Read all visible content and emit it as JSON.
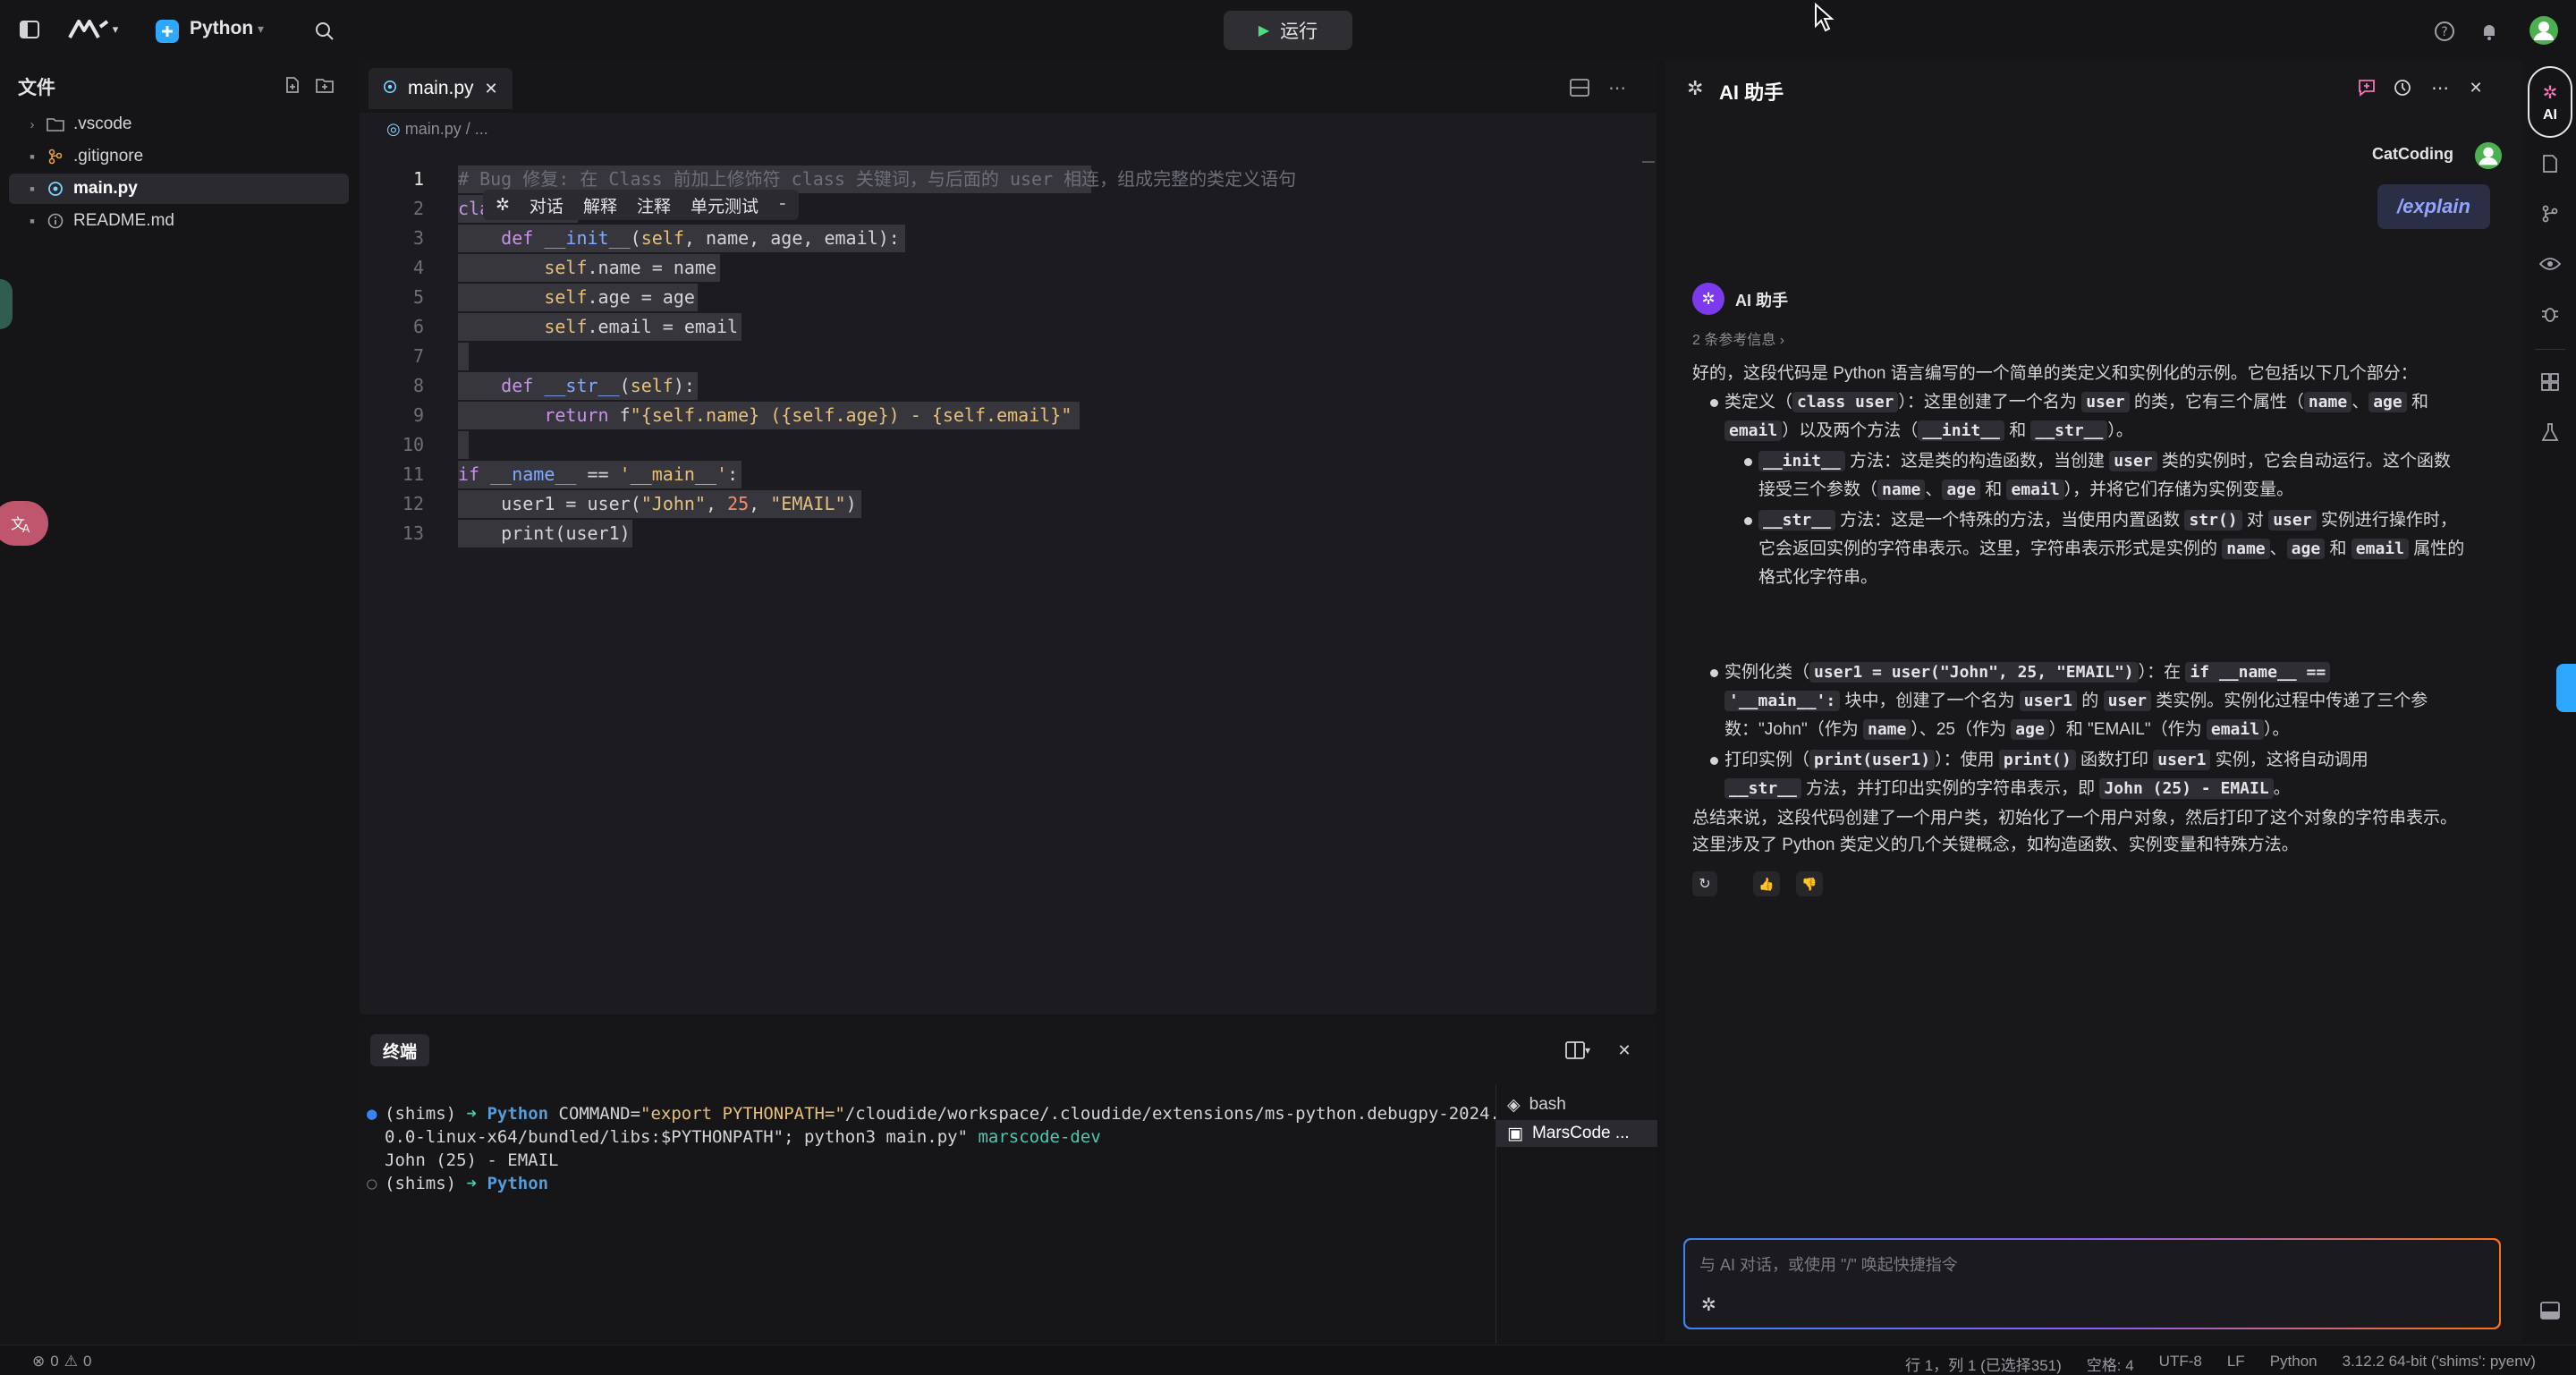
{
  "topbar": {
    "project_name": "Python",
    "run_label": "运行"
  },
  "sidebar": {
    "title": "文件",
    "items": [
      {
        "label": ".vscode",
        "type": "folder"
      },
      {
        "label": ".gitignore",
        "type": "git"
      },
      {
        "label": "main.py",
        "type": "python",
        "selected": true
      },
      {
        "label": "README.md",
        "type": "info"
      }
    ]
  },
  "editor": {
    "tab_label": "main.py",
    "breadcrumb": "main.py / ...",
    "inline_menu": [
      "对话",
      "解释",
      "注释",
      "单元测试"
    ],
    "lines": [
      "# Bug 修复: 在 Class 前加上修饰符 class 关键词，与后面的 user 相连，组成完整的类定义语句",
      "class user:",
      "    def __init__(self, name, age, email):",
      "        self.name = name",
      "        self.age = age",
      "        self.email = email",
      "",
      "    def __str__(self):",
      "        return f\"{self.name} ({self.age}) - {self.email}\"",
      "",
      "if __name__ == '__main__':",
      "    user1 = user(\"John\", 25, \"EMAIL\")",
      "    print(user1)"
    ]
  },
  "terminal": {
    "tab_label": "终端",
    "line1_prefix": "(shims)",
    "line1_cwd": "Python",
    "line1_cmd_a": "COMMAND=",
    "line1_cmd_b": "\"export PYTHONPATH=\"",
    "line1_cmd_c": "/cloudide/workspace/.cloudide/extensions/ms-python.debugpy-2024.",
    "line2": "0.0-linux-x64/bundled/libs:$PYTHONPATH\"; python3 main.py\"",
    "line2_tail": "marscode-dev",
    "line3": "John (25) - EMAIL",
    "line4_prefix": "(shims)",
    "line4_cwd": "Python",
    "sessions": [
      {
        "label": "bash",
        "selected": false
      },
      {
        "label": "MarsCode ...",
        "selected": true
      }
    ]
  },
  "ai": {
    "title": "AI 助手",
    "user_name": "CatCoding",
    "user_command": "/explain",
    "assistant_name": "AI 助手",
    "refs": "2 条参考信息",
    "intro": "好的，这段代码是 Python 语言编写的一个简单的类定义和实例化的示例。它包括以下几个部分：",
    "b1_a": "类定义（",
    "b1_chip1": "class user",
    "b1_b": "）：这里创建了一个名为",
    "b1_chip2": "user",
    "b1_c": "的类，它有三个属性（",
    "b1_chip3": "name",
    "b1_d": "、",
    "b1_chip4": "age",
    "b1_e": "和",
    "b1_chip5": "email",
    "b1_f": "）以及两个方法（",
    "b1_chip6": "__init__",
    "b1_g": "和",
    "b1_chip7": "__str__",
    "b1_h": "）。",
    "s1_chip": "__init__",
    "s1_a": "方法：这是类的构造函数，当创建",
    "s1_chip2": "user",
    "s1_b": "类的实例时，它会自动运行。这个函数",
    "s1_c": "接受三个参数（",
    "s1_chip3": "name",
    "s1_d": "、",
    "s1_chip4": "age",
    "s1_e": "和",
    "s1_chip5": "email",
    "s1_f": "），并将它们存储为实例变量。",
    "s2_chip": "__str__",
    "s2_a": "方法：这是一个特殊的方法，当使用内置函数",
    "s2_chip2": "str()",
    "s2_b": "对",
    "s2_chip3": "user",
    "s2_c": "实例进行操作时，",
    "s2_d": "它会返回实例的字符串表示。这里，字符串表示形式是实例的",
    "s2_chip4": "name",
    "s2_e": "、",
    "s2_chip5": "age",
    "s2_f": "和",
    "s2_chip6": "email",
    "s2_g": "属性的",
    "s2_h": "格式化字符串。",
    "b2_a": "实例化类（",
    "b2_chip1": "user1 = user(\"John\", 25, \"EMAIL\")",
    "b2_b": "）：在",
    "b2_chip2": "if __name__ ==",
    "b2_chip3": "'__main__':",
    "b2_c": "块中，创建了一个名为",
    "b2_chip4": "user1",
    "b2_d": "的",
    "b2_chip5": "user",
    "b2_e": "类实例。实例化过程中传递了三个参",
    "b2_f": "数：\"John\"（作为",
    "b2_chip6": "name",
    "b2_g": "）、25（作为",
    "b2_chip7": "age",
    "b2_h": "）和 \"EMAIL\"（作为",
    "b2_chip8": "email",
    "b2_i": "）。",
    "b3_a": "打印实例（",
    "b3_chip1": "print(user1)",
    "b3_b": "）：使用",
    "b3_chip2": "print()",
    "b3_c": "函数打印",
    "b3_chip3": "user1",
    "b3_d": "实例，这将自动调用",
    "b3_chip4": "__str__",
    "b3_e": "方法，并打印出实例的字符串表示，即",
    "b3_chip5": "John (25) - EMAIL",
    "b3_f": "。",
    "summary1": "总结来说，这段代码创建了一个用户类，初始化了一个用户对象，然后打印了这个对象的字符串表示。",
    "summary2": "这里涉及了 Python 类定义的几个关键概念，如构造函数、实例变量和特殊方法。",
    "input_placeholder": "与 AI 对话，或使用 \"/\" 唤起快捷指令"
  },
  "activity": {
    "ai_label": "AI"
  },
  "statusbar": {
    "errors": "0",
    "warnings": "0",
    "position": "行 1，列 1 (已选择351)",
    "spaces": "空格: 4",
    "encoding": "UTF-8",
    "eol": "LF",
    "language": "Python",
    "interpreter": "3.12.2 64-bit ('shims': pyenv)"
  },
  "colors": {
    "accent": "#2ea8ff",
    "ai_gradient_start": "#3b82f6",
    "ai_gradient_end": "#f97316",
    "avatar_green": "#4caf50"
  }
}
